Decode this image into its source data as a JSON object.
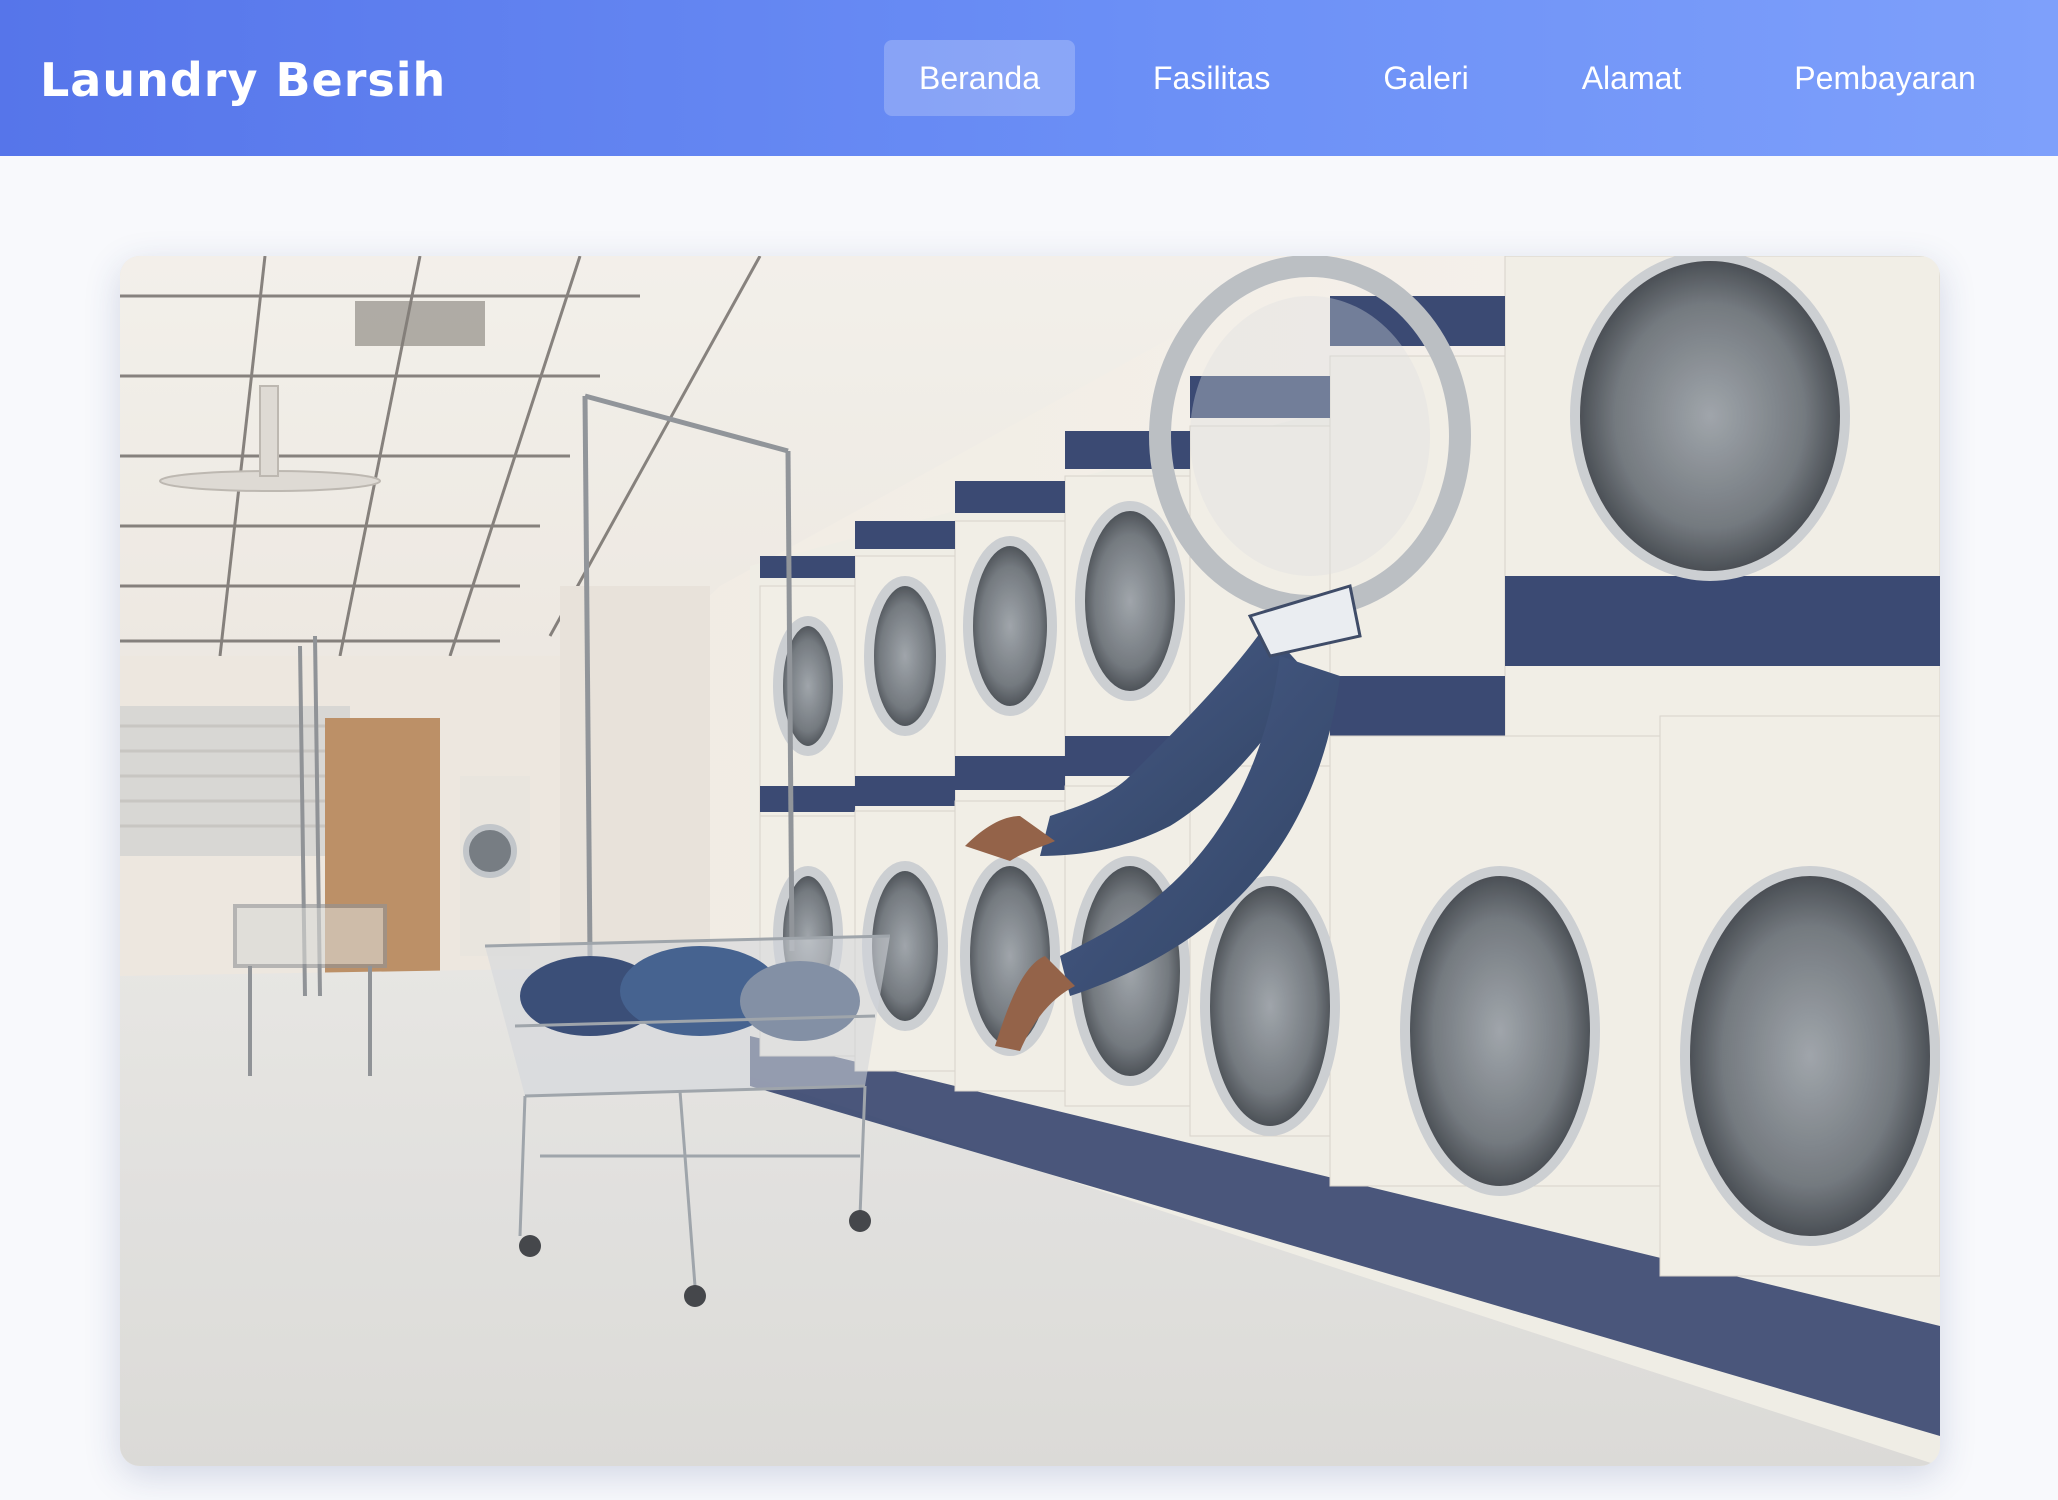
{
  "navbar": {
    "brand": "Laundry Bersih",
    "links": [
      {
        "label": "Beranda",
        "active": true
      },
      {
        "label": "Fasilitas",
        "active": false
      },
      {
        "label": "Galeri",
        "active": false
      },
      {
        "label": "Alamat",
        "active": false
      },
      {
        "label": "Pembayaran",
        "active": false
      }
    ]
  },
  "hero": {
    "image": "laundromat-photo-person-climbing-into-washing-machine"
  },
  "colors": {
    "nav_gradient_start": "#5675ea",
    "nav_gradient_end": "#7ea0fb",
    "page_background": "#f8f9fc",
    "machine_trim_navy": "#2b3b66"
  }
}
